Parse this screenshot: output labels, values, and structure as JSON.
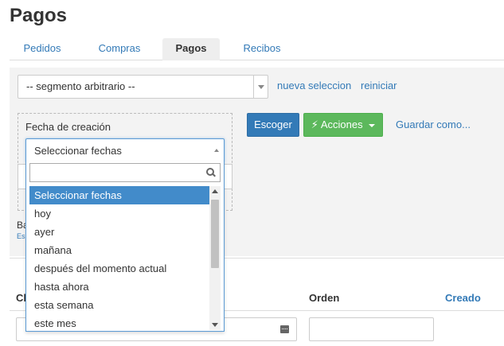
{
  "page": {
    "title": "Pagos"
  },
  "tabs": [
    {
      "label": "Pedidos",
      "active": false
    },
    {
      "label": "Compras",
      "active": false
    },
    {
      "label": "Pagos",
      "active": true
    },
    {
      "label": "Recibos",
      "active": false
    }
  ],
  "filter": {
    "segment_value": "-- segmento arbitrario --",
    "new_selection_label": "nueva seleccion",
    "reset_label": "reiniciar",
    "date_label": "Fecha de creación",
    "choose_button": "Escoger",
    "actions_button": "Acciones",
    "save_as_link": "Guardar como...",
    "bottom_text": "Ba",
    "bottom_link": "Es"
  },
  "date_dropdown": {
    "selected": "Seleccionar fechas",
    "search_placeholder": "",
    "options": [
      "Seleccionar fechas",
      "hoy",
      "ayer",
      "mañana",
      "después del momento actual",
      "hasta ahora",
      "esta semana",
      "este mes"
    ],
    "highlighted_index": 0
  },
  "table": {
    "columns": [
      {
        "label": "Cl",
        "link": false
      },
      {
        "label": "Orden",
        "link": false
      },
      {
        "label": "Creado",
        "link": true
      }
    ]
  },
  "colors": {
    "primary": "#337ab7",
    "success": "#5cb85c",
    "link": "#337ab7",
    "highlight": "#428bca"
  },
  "icons": {
    "segment_caret": "chevron-down-icon",
    "actions": "bolt-icon",
    "dropdown_caret": "chevron-up-icon",
    "search": "search-icon",
    "calendar": "calendar-icon"
  }
}
